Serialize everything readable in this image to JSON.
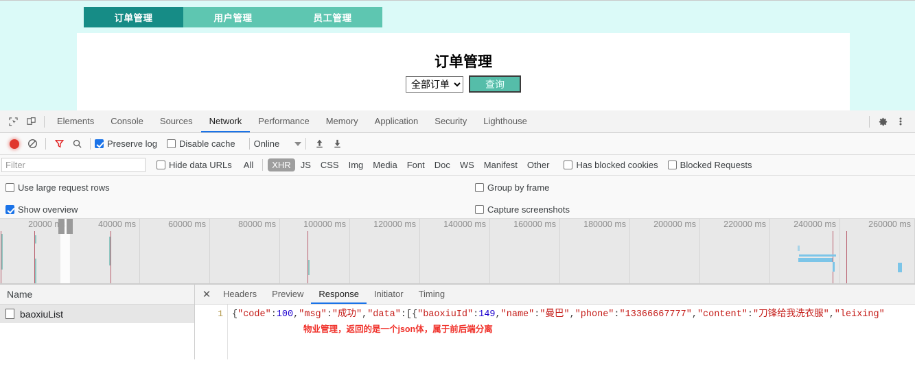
{
  "webpage": {
    "nav_tabs": [
      {
        "label": "订单管理",
        "active": true
      },
      {
        "label": "用户管理",
        "active": false
      },
      {
        "label": "员工管理",
        "active": false
      }
    ],
    "title": "订单管理",
    "select_value": "全部订单",
    "select_options": [
      "全部订单"
    ],
    "query_button": "查询",
    "colors": {
      "active_tab": "#168c86",
      "inactive_tab": "#5ec6b1",
      "page_bg": "#dbfaf8",
      "button": "#55bda9"
    }
  },
  "devtools": {
    "icons": {
      "inspect": "inspect-element-icon",
      "device": "device-toolbar-icon",
      "settings": "gear-icon",
      "more": "more-options-icon"
    },
    "tabs": [
      {
        "label": "Elements",
        "active": false
      },
      {
        "label": "Console",
        "active": false
      },
      {
        "label": "Sources",
        "active": false
      },
      {
        "label": "Network",
        "active": true
      },
      {
        "label": "Performance",
        "active": false
      },
      {
        "label": "Memory",
        "active": false
      },
      {
        "label": "Application",
        "active": false
      },
      {
        "label": "Security",
        "active": false
      },
      {
        "label": "Lighthouse",
        "active": false
      }
    ],
    "toolbar": {
      "record_icon": "record-icon",
      "clear_icon": "clear-icon",
      "filter_icon": "filter-icon",
      "search_icon": "search-icon",
      "preserve_log": {
        "label": "Preserve log",
        "checked": true
      },
      "disable_cache": {
        "label": "Disable cache",
        "checked": false
      },
      "throttling": "Online",
      "import_icon": "import-har-icon",
      "export_icon": "export-har-icon"
    },
    "filterbar": {
      "filter_placeholder": "Filter",
      "filter_value": "",
      "hide_data_urls": {
        "label": "Hide data URLs",
        "checked": false
      },
      "types": [
        {
          "label": "All",
          "selected": false
        },
        {
          "label": "XHR",
          "selected": true
        },
        {
          "label": "JS",
          "selected": false
        },
        {
          "label": "CSS",
          "selected": false
        },
        {
          "label": "Img",
          "selected": false
        },
        {
          "label": "Media",
          "selected": false
        },
        {
          "label": "Font",
          "selected": false
        },
        {
          "label": "Doc",
          "selected": false
        },
        {
          "label": "WS",
          "selected": false
        },
        {
          "label": "Manifest",
          "selected": false
        },
        {
          "label": "Other",
          "selected": false
        }
      ],
      "has_blocked_cookies": {
        "label": "Has blocked cookies",
        "checked": false
      },
      "blocked_requests": {
        "label": "Blocked Requests",
        "checked": false
      }
    },
    "options": {
      "use_large_request_rows": {
        "label": "Use large request rows",
        "checked": false
      },
      "group_by_frame": {
        "label": "Group by frame",
        "checked": false
      },
      "show_overview": {
        "label": "Show overview",
        "checked": true
      },
      "capture_screenshots": {
        "label": "Capture screenshots",
        "checked": false
      }
    },
    "overview": {
      "ticks": [
        "20000 ms",
        "40000 ms",
        "60000 ms",
        "80000 ms",
        "100000 ms",
        "120000 ms",
        "140000 ms",
        "160000 ms",
        "180000 ms",
        "200000 ms",
        "220000 ms",
        "240000 ms",
        "260000 ms"
      ]
    },
    "request_list": {
      "column_header": "Name",
      "rows": [
        {
          "name": "baoxiuList",
          "selected": true
        }
      ]
    },
    "detail": {
      "close_label": "✕",
      "tabs": [
        {
          "label": "Headers",
          "active": false
        },
        {
          "label": "Preview",
          "active": false
        },
        {
          "label": "Response",
          "active": true
        },
        {
          "label": "Initiator",
          "active": false
        },
        {
          "label": "Timing",
          "active": false
        }
      ],
      "line_number": "1",
      "response_parts": [
        {
          "text": "{",
          "type": "punct"
        },
        {
          "text": "\"code\"",
          "type": "key"
        },
        {
          "text": ":",
          "type": "punct"
        },
        {
          "text": "100",
          "type": "num"
        },
        {
          "text": ",",
          "type": "punct"
        },
        {
          "text": "\"msg\"",
          "type": "key"
        },
        {
          "text": ":",
          "type": "punct"
        },
        {
          "text": "\"成功\"",
          "type": "key"
        },
        {
          "text": ",",
          "type": "punct"
        },
        {
          "text": "\"data\"",
          "type": "key"
        },
        {
          "text": ":[{",
          "type": "punct"
        },
        {
          "text": "\"baoxiuId\"",
          "type": "key"
        },
        {
          "text": ":",
          "type": "punct"
        },
        {
          "text": "149",
          "type": "num"
        },
        {
          "text": ",",
          "type": "punct"
        },
        {
          "text": "\"name\"",
          "type": "key"
        },
        {
          "text": ":",
          "type": "punct"
        },
        {
          "text": "\"曼巴\"",
          "type": "key"
        },
        {
          "text": ",",
          "type": "punct"
        },
        {
          "text": "\"phone\"",
          "type": "key"
        },
        {
          "text": ":",
          "type": "punct"
        },
        {
          "text": "\"13366667777\"",
          "type": "key"
        },
        {
          "text": ",",
          "type": "punct"
        },
        {
          "text": "\"content\"",
          "type": "key"
        },
        {
          "text": ":",
          "type": "punct"
        },
        {
          "text": "\"刀锋给我洗衣服\"",
          "type": "key"
        },
        {
          "text": ",",
          "type": "punct"
        },
        {
          "text": "\"leixing\"",
          "type": "key"
        }
      ],
      "annotation": "物业管理，返回的是一个json体，属于前后端分离",
      "annotation_color": "#f0312a"
    }
  }
}
